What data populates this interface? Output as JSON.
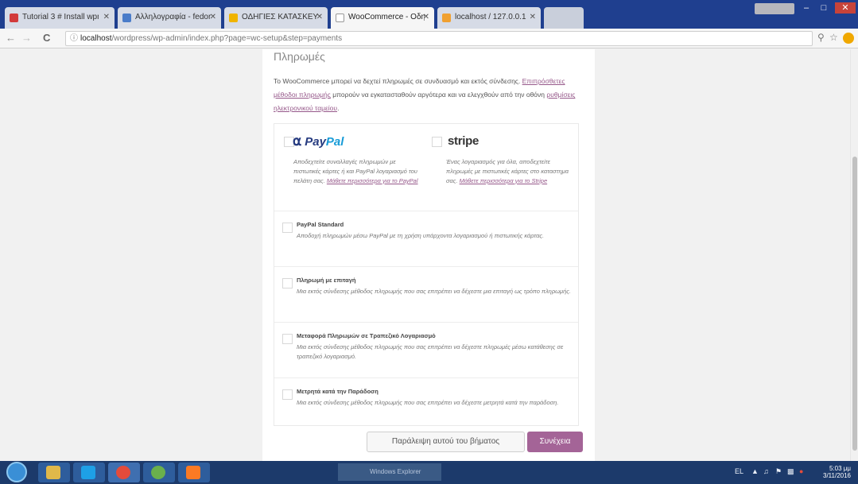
{
  "browser": {
    "tabs": [
      {
        "title": "Tutorial 3 # Install wpml",
        "favicon_color": "#d23a3a"
      },
      {
        "title": "Αλληλογραφία - fedora",
        "favicon_color": "#4a7cc9"
      },
      {
        "title": "ΟΔΗΓΙΕΣ ΚΑΤΑΣΚΕΥΗΣ",
        "favicon_color": "#f0b400"
      },
      {
        "title": "WooCommerce - Οδηγ",
        "favicon_color": "#ffffff",
        "active": true
      },
      {
        "title": "localhost / 127.0.0.1",
        "favicon_color": "#f0a030"
      }
    ],
    "url_host": "localhost",
    "url_path": "/wordpress/wp-admin/index.php?page=wc-setup&step=payments",
    "back_icon": "back-arrow-icon",
    "forward_icon": "forward-arrow-icon",
    "reload_icon": "reload-icon",
    "close_glyph": "✕"
  },
  "page": {
    "heading": "Πληρωμές",
    "intro_part1": "Το WooCommerce μπορεί να δεχτεί πληρωμές σε συνδυασμό και εκτός σύνδεσης. ",
    "intro_link1": "Επιπρόσθετες μέθοδοι πληρωμής",
    "intro_part2": " μπορούν να εγκατασταθούν αργότερα και να ελεγχθούν από την οθόνη ",
    "intro_link2": "ρυθμίσεις ηλεκτρονικού ταμείου",
    "intro_part3": ".",
    "featured": [
      {
        "logo_text_a": "Pay",
        "logo_text_b": "Pal",
        "desc": "Αποδεχτείτε συναλλαγές πληρωμών με πιστωτικές κάρτες ή και PayPal λογαριασμό του πελάτη σας. ",
        "link": "Μάθετε περισσότερα για το PayPal"
      },
      {
        "logo_text": "stripe",
        "desc": "Ένας λογαριασμός για όλα, αποδεχτείτε πληρωμές με πιστωτικές κάρτες στο καταστημα σας. ",
        "link": "Μάθετε περισσότερα για το Stripe"
      }
    ],
    "methods": [
      {
        "title": "PayPal Standard",
        "desc": "Αποδοχή πληρωμών μέσω PayPal με τη χρήση υπάρχοντα λογαριασμού ή πιστωτικής κάρτας."
      },
      {
        "title": "Πληρωμή με επιταγή",
        "desc": "Μια εκτός σύνδεσης μέθοδος πληρωμής που σας επιτρέπει να δέχεστε μια επιταγή ως τρόπο πληρωμής."
      },
      {
        "title": "Μεταφορά Πληρωμών σε Τραπεζικό Λογαριασμό",
        "desc": "Μια εκτός σύνδεσης μέθοδος πληρωμής που σας επιτρέπει να δέχεστε πληρωμές μέσω κατάθεσης σε τραπεζικό λογαριασμό."
      },
      {
        "title": "Μετρητά κατά την Παράδοση",
        "desc": "Μια εκτός σύνδεσης μέθοδος πληρωμής που σας επιτρέπει να δέχεστε μετρητά κατά την παράδοση."
      }
    ],
    "skip_label": "Παράλειψη αυτού του βήματος",
    "continue_label": "Συνέχεια"
  },
  "taskbar": {
    "ghost_title": "Windows Explorer",
    "lang": "EL",
    "clock_time": "5:03 μμ",
    "clock_date": "3/11/2016",
    "apps": [
      {
        "name": "explorer",
        "color": "#e0b84a"
      },
      {
        "name": "skype",
        "color": "#1ea0e6"
      },
      {
        "name": "chrome",
        "color": "#e44b3b"
      },
      {
        "name": "paint",
        "color": "#6ab04c"
      },
      {
        "name": "xampp",
        "color": "#fb7a24"
      }
    ]
  },
  "colors": {
    "accent": "#a46497",
    "link": "#96588a",
    "taskbar": "#1c3a6b"
  }
}
